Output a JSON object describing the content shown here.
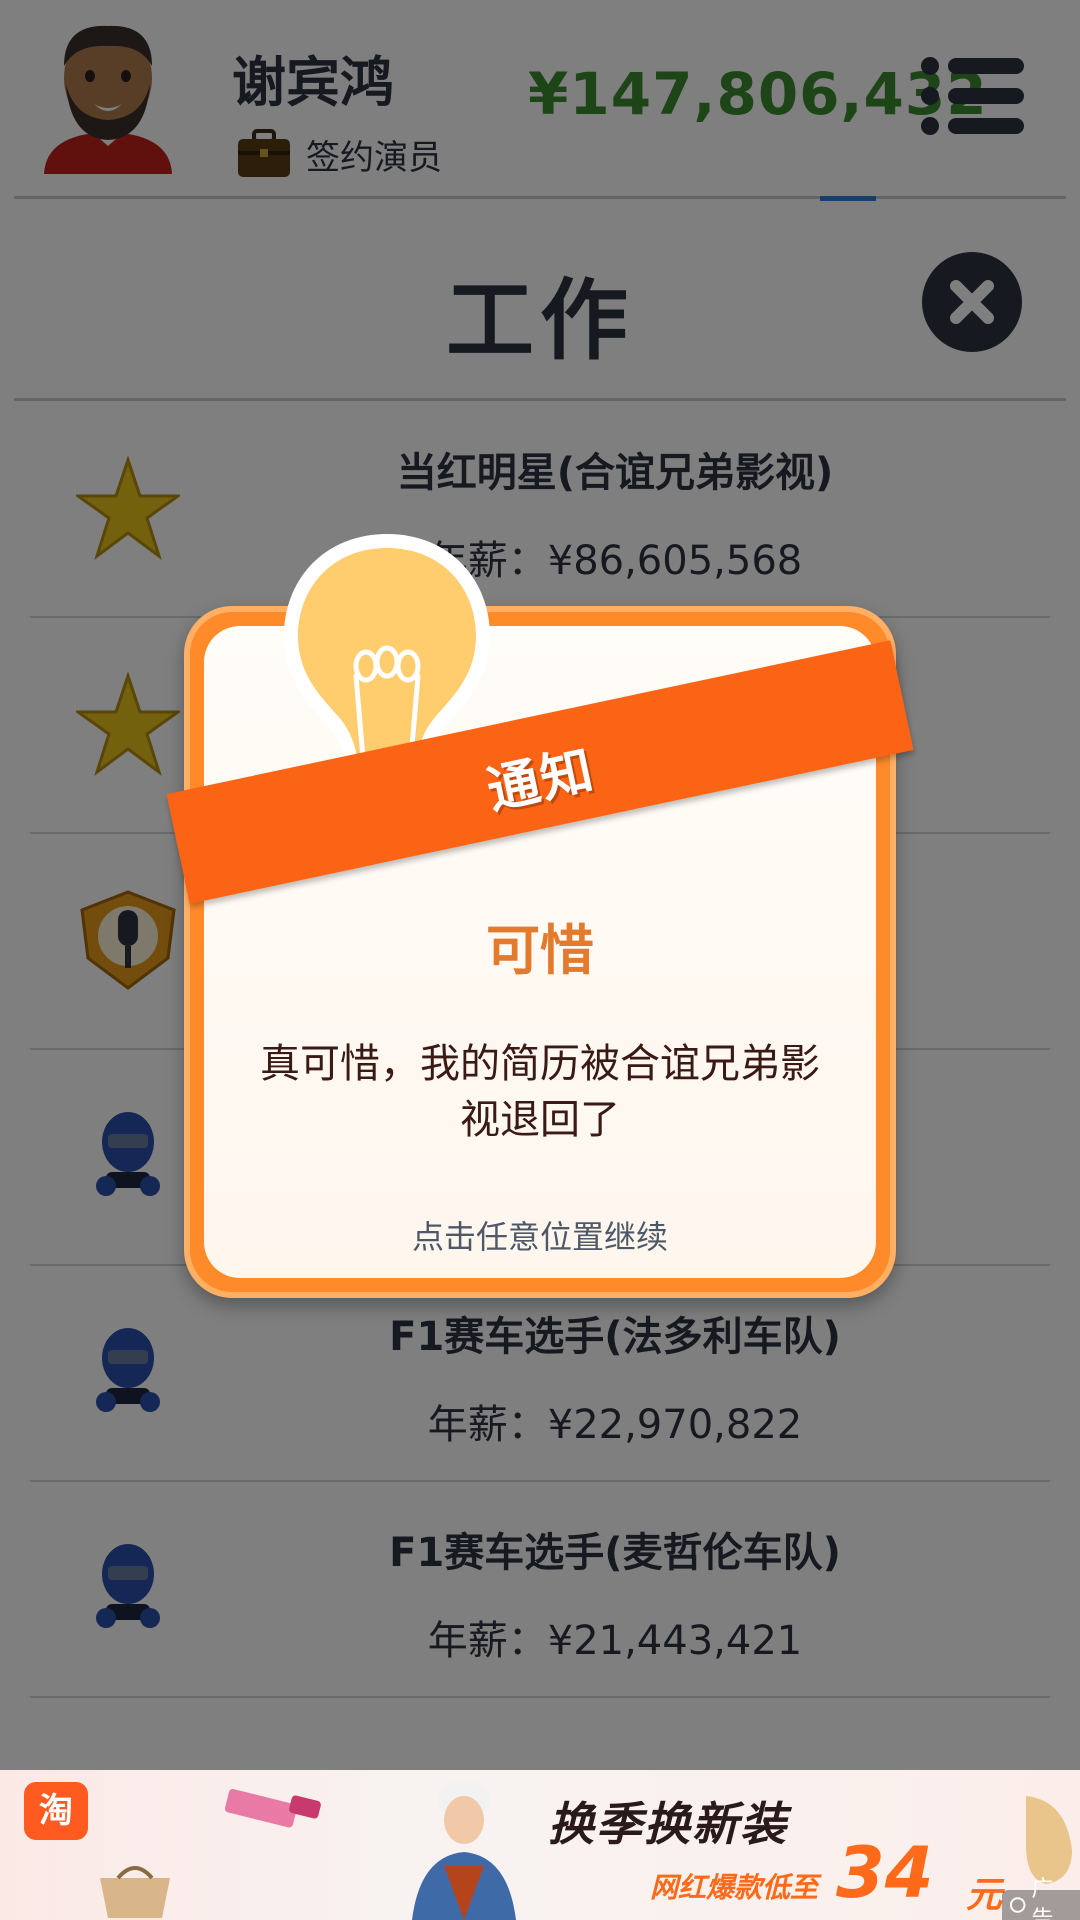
{
  "header": {
    "player_name": "谢宾鸿",
    "job_title": "签约演员",
    "money": "¥147,806,432",
    "avatar_icon": "bearded-man-avatar",
    "briefcase_icon": "briefcase-icon",
    "menu_icon": "menu-icon"
  },
  "page": {
    "title": "工作",
    "close_icon": "close-icon"
  },
  "jobs": [
    {
      "icon": "star-icon",
      "name": "当红明星(合谊兄弟影视)",
      "salary": "年薪：¥86,605,568"
    },
    {
      "icon": "star-icon",
      "name": "",
      "salary": ""
    },
    {
      "icon": "microphone-badge-icon",
      "name": "",
      "salary": ""
    },
    {
      "icon": "racer-helmet-icon",
      "name": "",
      "salary": ""
    },
    {
      "icon": "racer-helmet-icon",
      "name": "F1赛车选手(法多利车队)",
      "salary": "年薪：¥22,970,822"
    },
    {
      "icon": "racer-helmet-icon",
      "name": "F1赛车选手(麦哲伦车队)",
      "salary": "年薪：¥21,443,421"
    }
  ],
  "modal": {
    "banner": "通知",
    "heading": "可惜",
    "message": "真可惜，我的简历被合谊兄弟影视退回了",
    "hint": "点击任意位置继续",
    "icon": "lightbulb-icon"
  },
  "ad": {
    "logo": "淘",
    "headline": "换季换新装",
    "subline": "网红爆款低至",
    "price": "34",
    "unit": "元",
    "label": "广告"
  },
  "colors": {
    "money": "#3c8b2e",
    "accent_orange": "#fb6415",
    "modal_heading": "#e37a2c",
    "dark_text": "#2d3440"
  }
}
